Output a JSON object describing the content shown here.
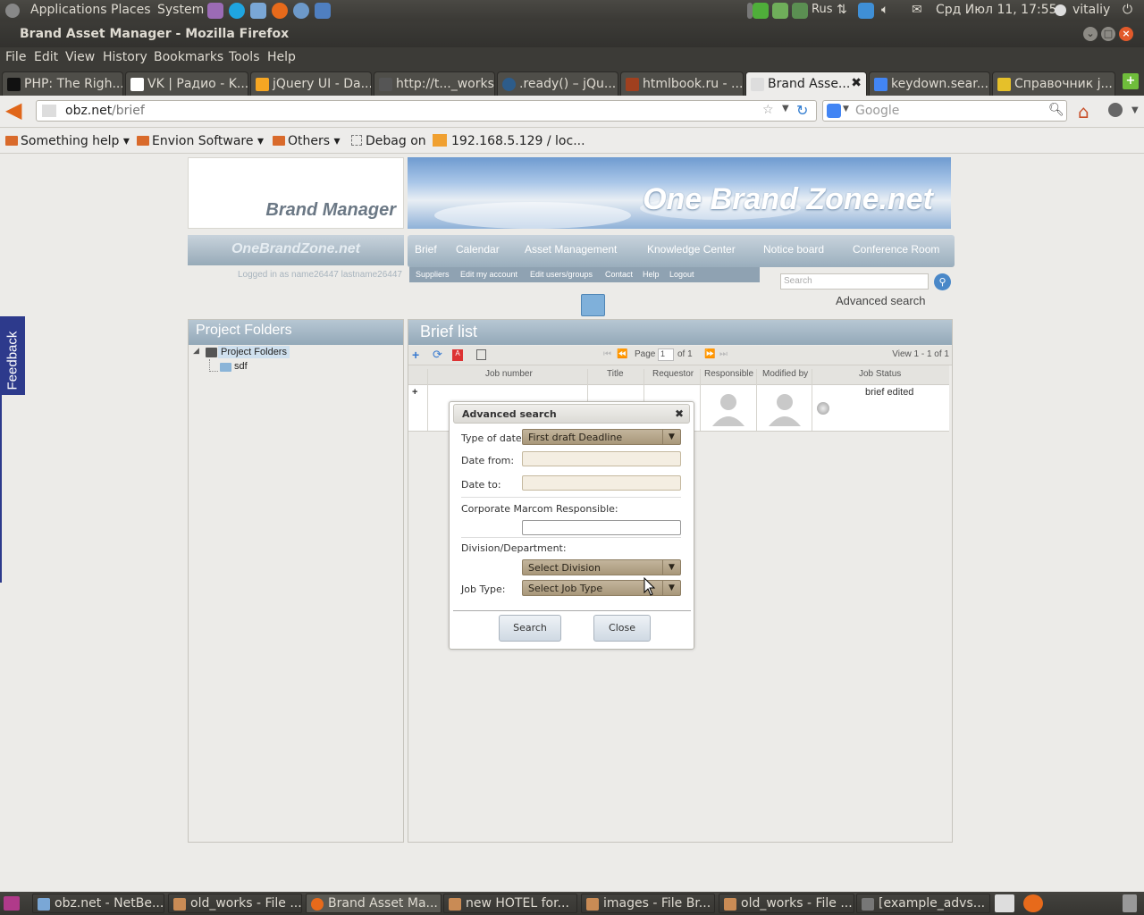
{
  "top_panel": {
    "menus": [
      "Applications",
      "Places",
      "System"
    ],
    "keyboard_layout": "Rus",
    "datetime": "Срд Июл 11, 17:55",
    "user": "vitaliy"
  },
  "window": {
    "title": "Brand Asset Manager - Mozilla Firefox"
  },
  "menubar": [
    "File",
    "Edit",
    "View",
    "History",
    "Bookmarks",
    "Tools",
    "Help"
  ],
  "tabs": [
    {
      "label": "PHP: The Righ..."
    },
    {
      "label": "VK | Радио - K..."
    },
    {
      "label": "jQuery UI - Da..."
    },
    {
      "label": "http://t..._works/"
    },
    {
      "label": ".ready() – jQu..."
    },
    {
      "label": "htmlbook.ru - ..."
    },
    {
      "label": "Brand Asse..."
    },
    {
      "label": "keydown.sear..."
    },
    {
      "label": "Справочник j..."
    }
  ],
  "navbar": {
    "url_host": "obz.net",
    "url_path": "/brief",
    "search_placeholder": "Google"
  },
  "bookmarks": [
    {
      "label": "Something help"
    },
    {
      "label": "Envion Software"
    },
    {
      "label": "Others"
    },
    {
      "label": "Debag on"
    },
    {
      "label": "192.168.5.129 / loc..."
    }
  ],
  "site": {
    "logo_text": "Brand Manager",
    "banner_text": "One Brand Zone.net",
    "left_logo": "OneBrandZone.net",
    "logged_in": "Logged in as name26447 lastname26447",
    "nav": [
      "Brief",
      "Calendar",
      "Asset Management",
      "Knowledge Center",
      "Notice board",
      "Conference Room"
    ],
    "subnav": [
      "Suppliers",
      "Edit my account",
      "Edit users/groups",
      "Contact",
      "Help",
      "Logout"
    ],
    "search_placeholder": "Search",
    "advanced_search_link": "Advanced search"
  },
  "left_panel": {
    "title": "Project Folders",
    "tree_root": "Project Folders",
    "tree_child": "sdf"
  },
  "brief_list": {
    "title": "Brief list",
    "pager": {
      "page_label": "Page",
      "page_value": "1",
      "of_label": "of 1",
      "view_info": "View 1 - 1 of 1"
    },
    "columns": [
      "Job number",
      "Title",
      "Requestor",
      "Responsible",
      "Modified by",
      "Job Status"
    ],
    "row": {
      "expand": "+",
      "job_status": "brief edited"
    }
  },
  "dialog": {
    "title": "Advanced search",
    "close_glyph": "✖",
    "type_of_date_label": "Type of date:",
    "type_of_date_value": "First draft Deadline",
    "date_from_label": "Date from:",
    "date_to_label": "Date to:",
    "marcom_label": "Corporate Marcom Responsible:",
    "division_label": "Division/Department:",
    "division_value": "Select Division",
    "jobtype_label": "Job Type:",
    "jobtype_value": "Select Job Type",
    "search_button": "Search",
    "close_button": "Close"
  },
  "feedback_label": "Feedback",
  "taskbar": [
    {
      "label": "obz.net - NetBe..."
    },
    {
      "label": "old_works - File ..."
    },
    {
      "label": "Brand Asset Ma..."
    },
    {
      "label": "new HOTEL for..."
    },
    {
      "label": "images - File Br..."
    },
    {
      "label": "old_works - File ..."
    },
    {
      "label": "[example_advs..."
    }
  ]
}
